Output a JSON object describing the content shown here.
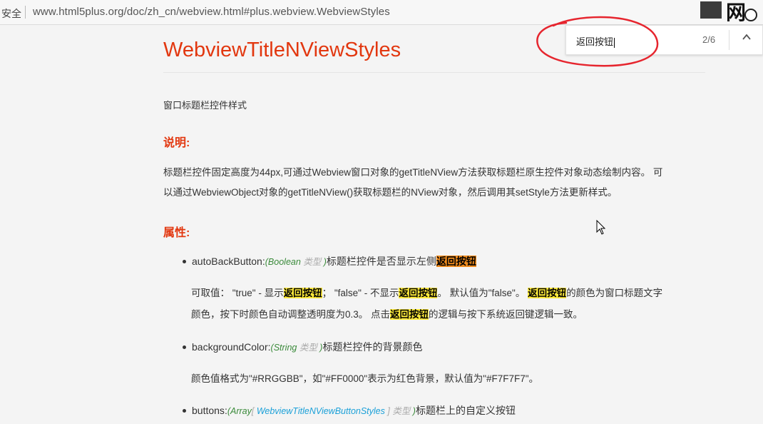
{
  "browser": {
    "security_label": "安全",
    "url": "www.html5plus.org/doc/zh_cn/webview.html#plus.webview.WebviewStyles",
    "corner_logo_text": "网"
  },
  "find_bar": {
    "query": "返回按钮",
    "match_count": "2/6",
    "up_icon": "chevron-up-icon"
  },
  "page": {
    "title": "WebviewTitleNViewStyles",
    "description": "窗口标题栏控件样式",
    "section_note": "说明:",
    "note_para_1": "标题栏控件固定高度为44px,可通过Webview窗口对象的getTitleNView方法获取标题栏原生控件对象动态绘制内容。 可",
    "note_para_2": "以通过WebviewObject对象的getTitleNView()获取标题栏的NView对象，然后调用其setStyle方法更新样式。",
    "section_props": "属性:",
    "props": [
      {
        "name": "autoBackButton",
        "colon": ":",
        "type_open": "(",
        "type_name": "Boolean",
        "type_word": " 类型 ",
        "type_close": ")",
        "desc": "标题栏控件是否显示左侧",
        "desc_hl": "返回按钮",
        "sub_1a": "可取值： \"true\" - 显示",
        "sub_1b": "； \"false\" - 不显示",
        "sub_1c": "。 默认值为\"false\"。 ",
        "sub_1d": "的颜色为窗口标题文字",
        "sub_2a": "颜色，按下时颜色自动调整透明度为0.3。 点击",
        "sub_2b": "的逻辑与按下系统返回键逻辑一致。",
        "hl": "返回按钮"
      },
      {
        "name": "backgroundColor",
        "colon": ":",
        "type_open": "(",
        "type_name": "String",
        "type_word": " 类型 ",
        "type_close": ")",
        "desc": "标题栏控件的背景颜色",
        "sub": "颜色值格式为\"#RRGGBB\"，如\"#FF0000\"表示为红色背景，默认值为\"#F7F7F7\"。"
      },
      {
        "name": "buttons",
        "colon": ":",
        "type_open": "(",
        "type_name": "Array",
        "type_bracket_open": "[ ",
        "type_inner": "WebviewTitleNViewButtonStyles",
        "type_bracket_close": " ]",
        "type_word": " 类型 ",
        "type_close": ")",
        "desc": "标题栏上的自定义按钮"
      }
    ]
  },
  "colors": {
    "heading_red": "#e2370f",
    "highlight": "#ffeb3b",
    "highlight_active": "#f08c1e",
    "type_green": "#3a8a3a",
    "type_blue": "#1aa0d8"
  }
}
